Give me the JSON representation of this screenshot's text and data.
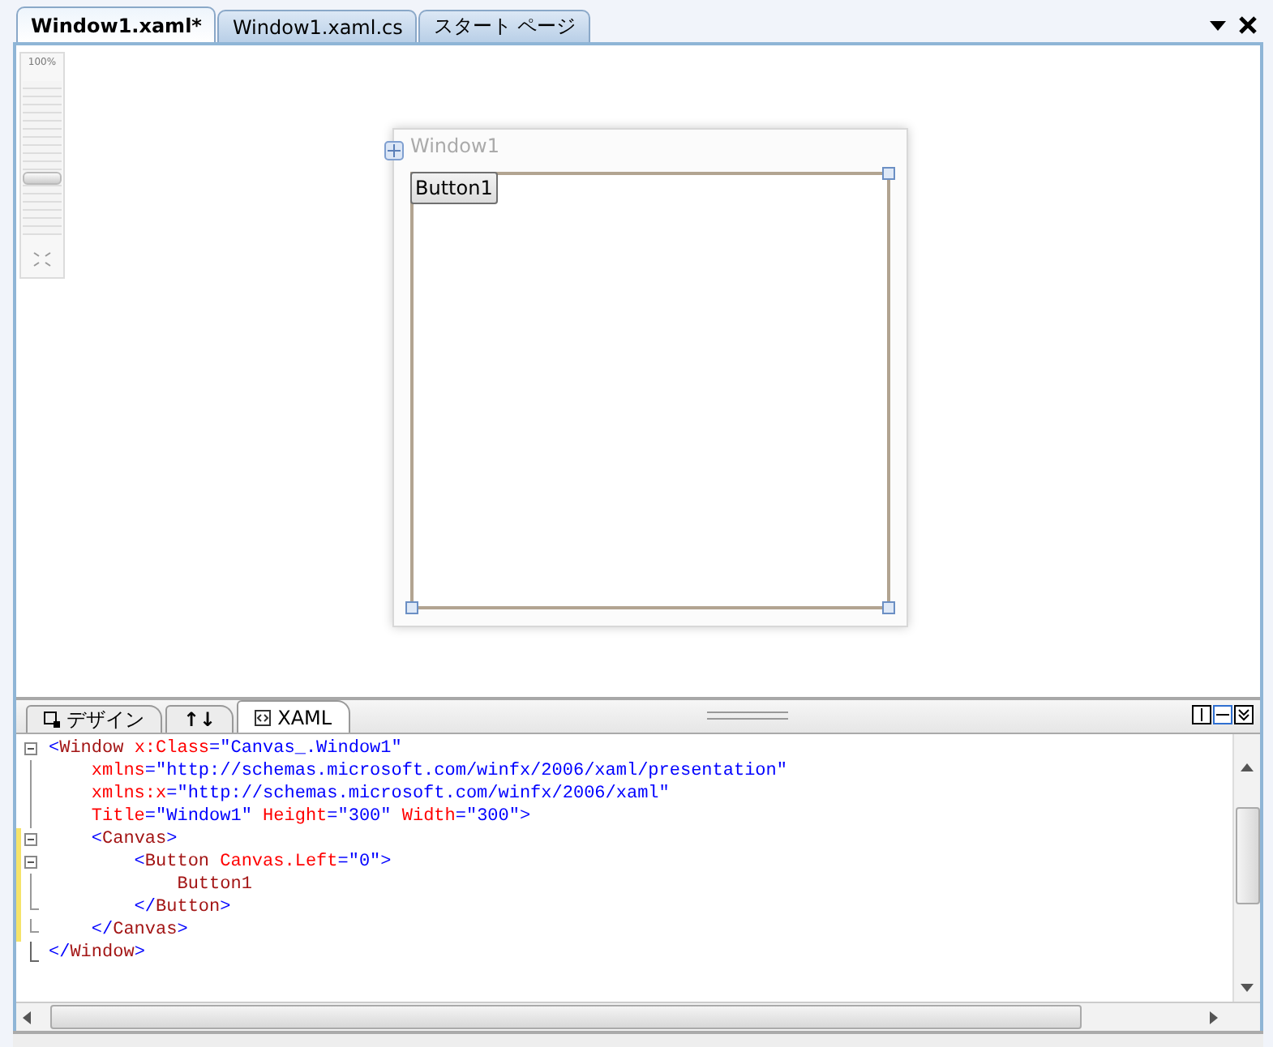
{
  "document_tabs": [
    {
      "label": "Window1.xaml*",
      "selected": true
    },
    {
      "label": "Window1.xaml.cs",
      "selected": false
    },
    {
      "label": "スタート ページ",
      "selected": false
    }
  ],
  "zoom": {
    "label": "100%",
    "level": 0.37
  },
  "preview_window": {
    "title": "Window1",
    "button": "Button1"
  },
  "view_tabs": [
    {
      "kind": "design",
      "label": "デザイン",
      "selected": false
    },
    {
      "kind": "swap",
      "label": "↑↓",
      "selected": false
    },
    {
      "kind": "xaml",
      "label": "XAML",
      "selected": true
    }
  ],
  "layout_buttons": [
    {
      "kind": "vertical",
      "selected": false
    },
    {
      "kind": "horizontal",
      "selected": true
    },
    {
      "kind": "collapse",
      "selected": false
    }
  ],
  "code_lines": [
    {
      "kind": "open",
      "changed": false,
      "tokens": [
        {
          "kind": "punct",
          "t": "<"
        },
        {
          "kind": "element",
          "t": "Window"
        },
        {
          "kind": "attribute",
          "t": " x:Class"
        },
        {
          "kind": "punct",
          "t": "=\"Canvas_.Window1\""
        }
      ]
    },
    {
      "kind": "line",
      "changed": false,
      "tokens": [
        {
          "kind": "attribute",
          "t": "    xmlns"
        },
        {
          "kind": "punct",
          "t": "=\"http://schemas.microsoft.com/winfx/2006/xaml/presentation\""
        }
      ]
    },
    {
      "kind": "line",
      "changed": false,
      "tokens": [
        {
          "kind": "attribute",
          "t": "    xmlns:x"
        },
        {
          "kind": "punct",
          "t": "=\"http://schemas.microsoft.com/winfx/2006/xaml\""
        }
      ]
    },
    {
      "kind": "line",
      "changed": false,
      "tokens": [
        {
          "kind": "attribute",
          "t": "    Title"
        },
        {
          "kind": "punct",
          "t": "=\"Window1\""
        },
        {
          "kind": "attribute",
          "t": " Height"
        },
        {
          "kind": "punct",
          "t": "=\"300\""
        },
        {
          "kind": "attribute",
          "t": " Width"
        },
        {
          "kind": "punct",
          "t": "=\"300\">"
        }
      ]
    },
    {
      "kind": "open",
      "changed": true,
      "tokens": [
        {
          "kind": "punct",
          "t": "    <"
        },
        {
          "kind": "element",
          "t": "Canvas"
        },
        {
          "kind": "punct",
          "t": ">"
        }
      ]
    },
    {
      "kind": "open",
      "changed": true,
      "tokens": [
        {
          "kind": "punct",
          "t": "        <"
        },
        {
          "kind": "element",
          "t": "Button"
        },
        {
          "kind": "attribute",
          "t": " Canvas.Left"
        },
        {
          "kind": "punct",
          "t": "=\"0\">"
        }
      ]
    },
    {
      "kind": "line",
      "changed": true,
      "tokens": [
        {
          "kind": "element",
          "t": "            Button1"
        }
      ]
    },
    {
      "kind": "end",
      "changed": true,
      "tokens": [
        {
          "kind": "punct",
          "t": "        </"
        },
        {
          "kind": "element",
          "t": "Button"
        },
        {
          "kind": "punct",
          "t": ">"
        }
      ]
    },
    {
      "kind": "end",
      "changed": true,
      "tokens": [
        {
          "kind": "punct",
          "t": "    </"
        },
        {
          "kind": "element",
          "t": "Canvas"
        },
        {
          "kind": "punct",
          "t": ">"
        }
      ]
    },
    {
      "kind": "last",
      "changed": false,
      "tokens": [
        {
          "kind": "punct",
          "t": "</"
        },
        {
          "kind": "element",
          "t": "Window"
        },
        {
          "kind": "punct",
          "t": ">"
        }
      ]
    }
  ]
}
